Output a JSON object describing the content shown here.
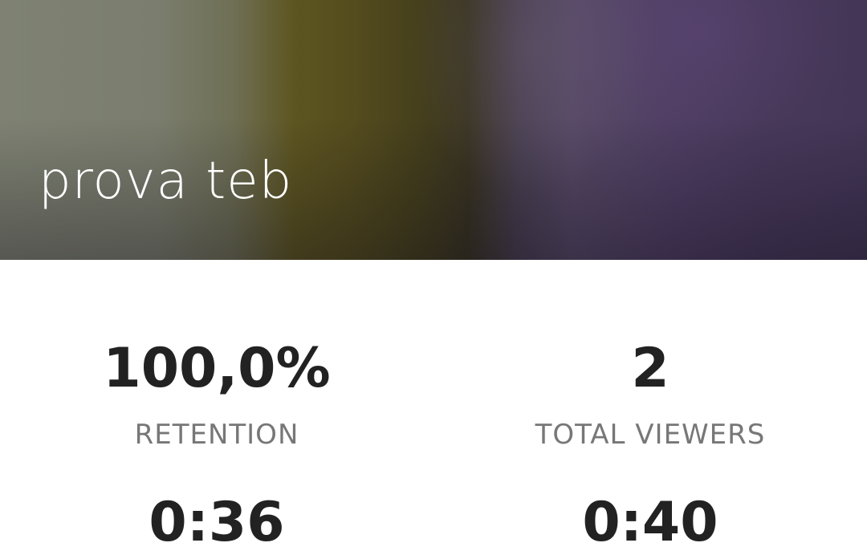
{
  "header": {
    "title": "prova teb"
  },
  "stats": {
    "retention": {
      "value": "100,0%",
      "label": "RETENTION"
    },
    "total_viewers": {
      "value": "2",
      "label": "TOTAL VIEWERS"
    },
    "row2_left": {
      "value": "0:36"
    },
    "row2_right": {
      "value": "0:40"
    }
  }
}
